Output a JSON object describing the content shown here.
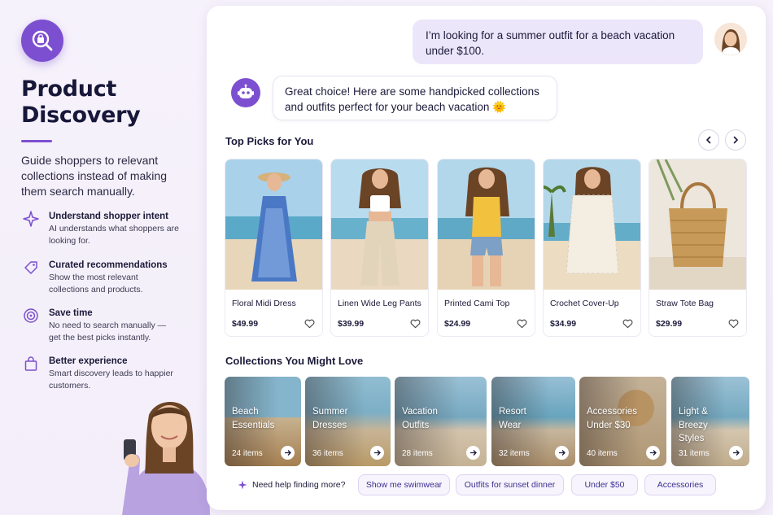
{
  "sidebar": {
    "title_line1": "Product",
    "title_line2": "Discovery",
    "intro": "Guide shoppers to relevant collections instead of making them search manually.",
    "features": [
      {
        "icon": "sparkle-icon",
        "title": "Understand shopper intent",
        "desc": "AI understands what shoppers are looking for."
      },
      {
        "icon": "tag-icon",
        "title": "Curated recommendations",
        "desc": "Show the most relevant collections and products."
      },
      {
        "icon": "target-icon",
        "title": "Save time",
        "desc": "No need to search manually — get the best picks instantly."
      },
      {
        "icon": "shopping-bag-icon",
        "title": "Better experience",
        "desc": "Smart discovery leads to happier customers."
      }
    ]
  },
  "chat": {
    "user_message": "I’m looking for a summer outfit for a beach vacation under $100.",
    "bot_message": "Great choice! Here are some handpicked collections and outfits perfect for your beach vacation 🌞"
  },
  "top_picks": {
    "heading": "Top Picks for You",
    "products": [
      {
        "name": "Floral Midi Dress",
        "price": "$49.99"
      },
      {
        "name": "Linen Wide Leg Pants",
        "price": "$39.99"
      },
      {
        "name": "Printed Cami Top",
        "price": "$24.99"
      },
      {
        "name": "Crochet Cover-Up",
        "price": "$34.99"
      },
      {
        "name": "Straw Tote Bag",
        "price": "$29.99"
      }
    ]
  },
  "collections": {
    "heading": "Collections You Might Love",
    "items": [
      {
        "title": "Beach\nEssentials",
        "count": "24 items"
      },
      {
        "title": "Summer\nDresses",
        "count": "36 items"
      },
      {
        "title": "Vacation\nOutfits",
        "count": "28 items"
      },
      {
        "title": "Resort\nWear",
        "count": "32 items"
      },
      {
        "title": "Accessories\nUnder $30",
        "count": "40 items"
      },
      {
        "title": "Light &\nBreezy\nStyles",
        "count": "31 items"
      }
    ]
  },
  "suggestions": {
    "prompt": "Need help finding more?",
    "chips": [
      "Show me swimwear",
      "Outfits for sunset dinner",
      "Under $50",
      "Accessories"
    ]
  },
  "colors": {
    "accent": "#7c4fd0",
    "bubble": "#ece6fa",
    "text": "#1c1a3a"
  }
}
